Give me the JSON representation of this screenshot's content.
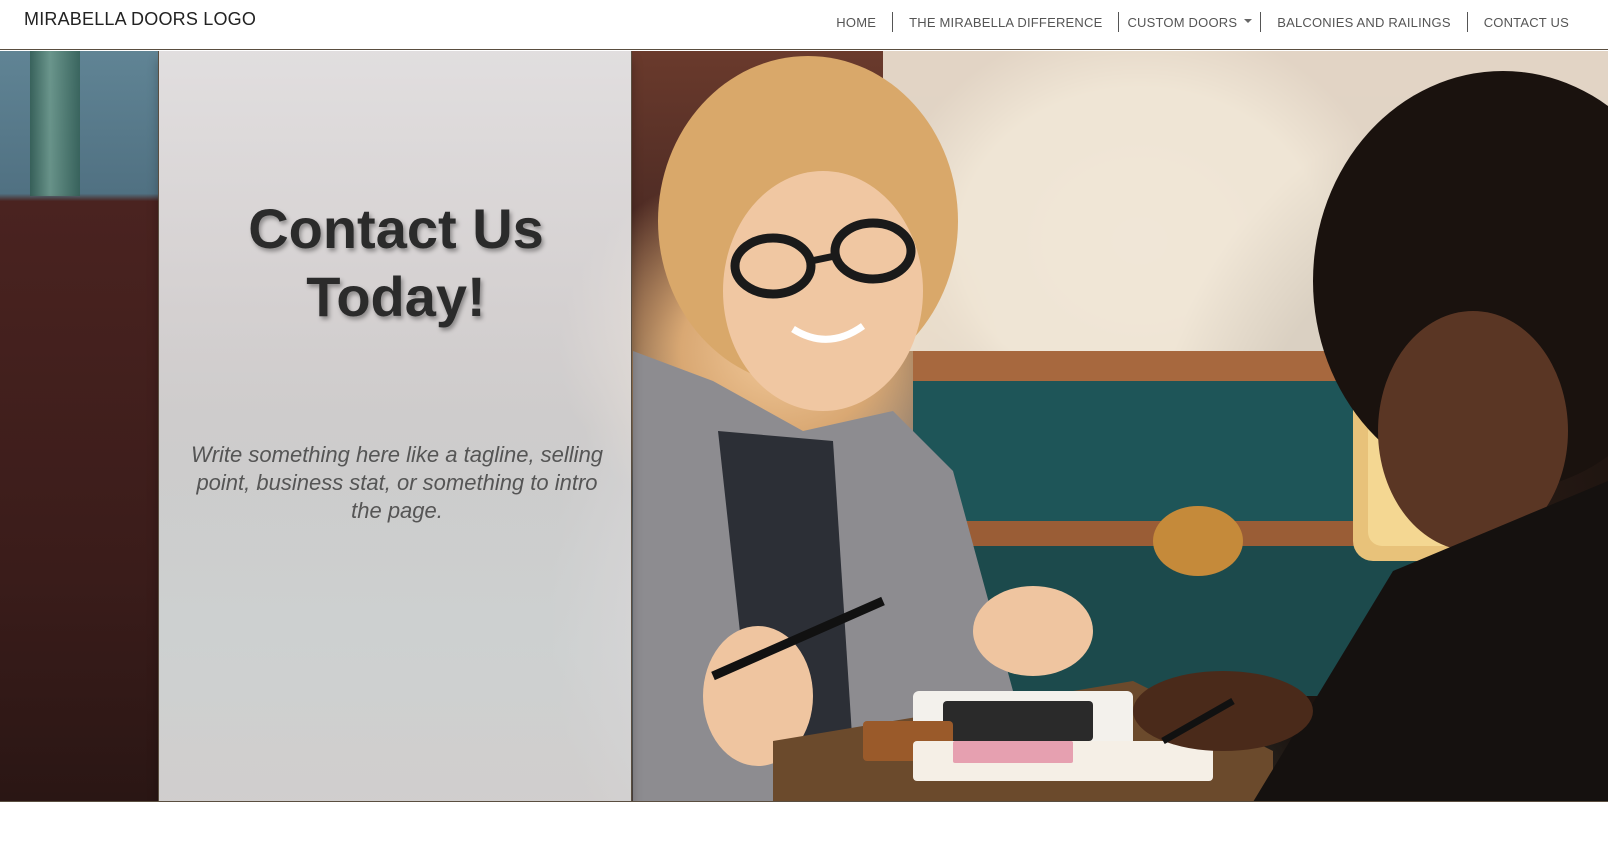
{
  "brand": {
    "logo_text": "MIRABELLA DOORS LOGO"
  },
  "nav": {
    "items": [
      {
        "label": "HOME"
      },
      {
        "label": "THE MIRABELLA DIFFERENCE"
      },
      {
        "label": "CUSTOM DOORS",
        "has_dropdown": true
      },
      {
        "label": "BALCONIES AND RAILINGS"
      },
      {
        "label": "CONTACT US"
      }
    ]
  },
  "hero": {
    "title_line1": "Contact Us",
    "title_line2": "Today!",
    "tagline": "Write something here like a tagline, selling point, business stat, or something to intro the page."
  },
  "icons": {
    "dropdown": "chevron-down-icon"
  },
  "colors": {
    "nav_text": "#555555",
    "title_text": "#2b2b2b",
    "border": "#5a4e40"
  }
}
